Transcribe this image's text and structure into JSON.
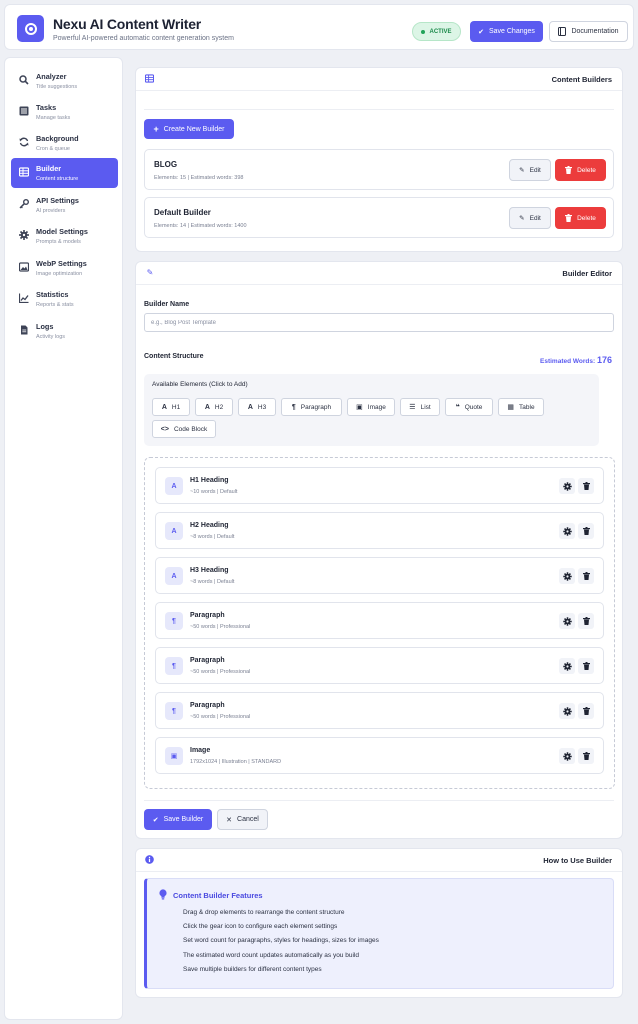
{
  "header": {
    "title": "Nexu AI Content Writer",
    "subtitle": "Powerful AI-powered automatic content generation system",
    "status": "ACTIVE",
    "save_label": "Save Changes",
    "docs_label": "Documentation"
  },
  "sidebar": {
    "items": [
      {
        "label": "Analyzer",
        "sub": "Title suggestions",
        "icon": "search-icon"
      },
      {
        "label": "Tasks",
        "sub": "Manage tasks",
        "icon": "tasks-icon"
      },
      {
        "label": "Background",
        "sub": "Cron & queue",
        "icon": "sync-icon"
      },
      {
        "label": "Builder",
        "sub": "Content structure",
        "icon": "table-icon"
      },
      {
        "label": "API Settings",
        "sub": "AI providers",
        "icon": "key-icon"
      },
      {
        "label": "Model Settings",
        "sub": "Prompts & models",
        "icon": "gear-icon"
      },
      {
        "label": "WebP Settings",
        "sub": "Image optimization",
        "icon": "image-icon"
      },
      {
        "label": "Statistics",
        "sub": "Reports & stats",
        "icon": "chart-icon"
      },
      {
        "label": "Logs",
        "sub": "Activity logs",
        "icon": "file-icon"
      }
    ],
    "active_index": 3
  },
  "builders_panel": {
    "title": "Content Builders",
    "create_label": "Create New Builder",
    "edit_label": "Edit",
    "delete_label": "Delete",
    "builders": [
      {
        "name": "BLOG",
        "meta": "Elements: 15 | Estimated words: 398"
      },
      {
        "name": "Default Builder",
        "meta": "Elements: 14 | Estimated words: 1400"
      }
    ]
  },
  "editor": {
    "title": "Builder Editor",
    "name_label": "Builder Name",
    "name_placeholder": "e.g., Blog Post Template",
    "name_value": "",
    "structure_label": "Content Structure",
    "est_words_label": "Estimated Words:",
    "est_words_value": "176",
    "available_label": "Available Elements (Click to Add)",
    "available": [
      {
        "icon": "A",
        "label": "H1"
      },
      {
        "icon": "A",
        "label": "H2"
      },
      {
        "icon": "A",
        "label": "H3"
      },
      {
        "icon": "¶",
        "label": "Paragraph"
      },
      {
        "icon": "▣",
        "label": "Image"
      },
      {
        "icon": "☰",
        "label": "List"
      },
      {
        "icon": "❝",
        "label": "Quote"
      },
      {
        "icon": "▦",
        "label": "Table"
      },
      {
        "icon": "<>",
        "label": "Code Block"
      }
    ],
    "elements": [
      {
        "badge": "A",
        "name": "H1 Heading",
        "meta": "~10 words | Default"
      },
      {
        "badge": "A",
        "name": "H2 Heading",
        "meta": "~8 words | Default"
      },
      {
        "badge": "A",
        "name": "H3 Heading",
        "meta": "~8 words | Default"
      },
      {
        "badge": "¶",
        "name": "Paragraph",
        "meta": "~50 words | Professional"
      },
      {
        "badge": "¶",
        "name": "Paragraph",
        "meta": "~50 words | Professional"
      },
      {
        "badge": "¶",
        "name": "Paragraph",
        "meta": "~50 words | Professional"
      },
      {
        "badge": "▣",
        "name": "Image",
        "meta": "1792x1024 | Illustration | STANDARD"
      }
    ],
    "save_label": "Save Builder",
    "cancel_label": "Cancel"
  },
  "help": {
    "title": "How to Use Builder",
    "box_title": "Content Builder Features",
    "items": [
      "Drag & drop elements to rearrange the content structure",
      "Click the gear icon to configure each element settings",
      "Set word count for paragraphs, styles for headings, sizes for images",
      "The estimated word count updates automatically as you build",
      "Save multiple builders for different content types"
    ]
  },
  "colors": {
    "accent": "#5b5bf0",
    "danger": "#ec3c3c",
    "success": "#22a35a"
  }
}
